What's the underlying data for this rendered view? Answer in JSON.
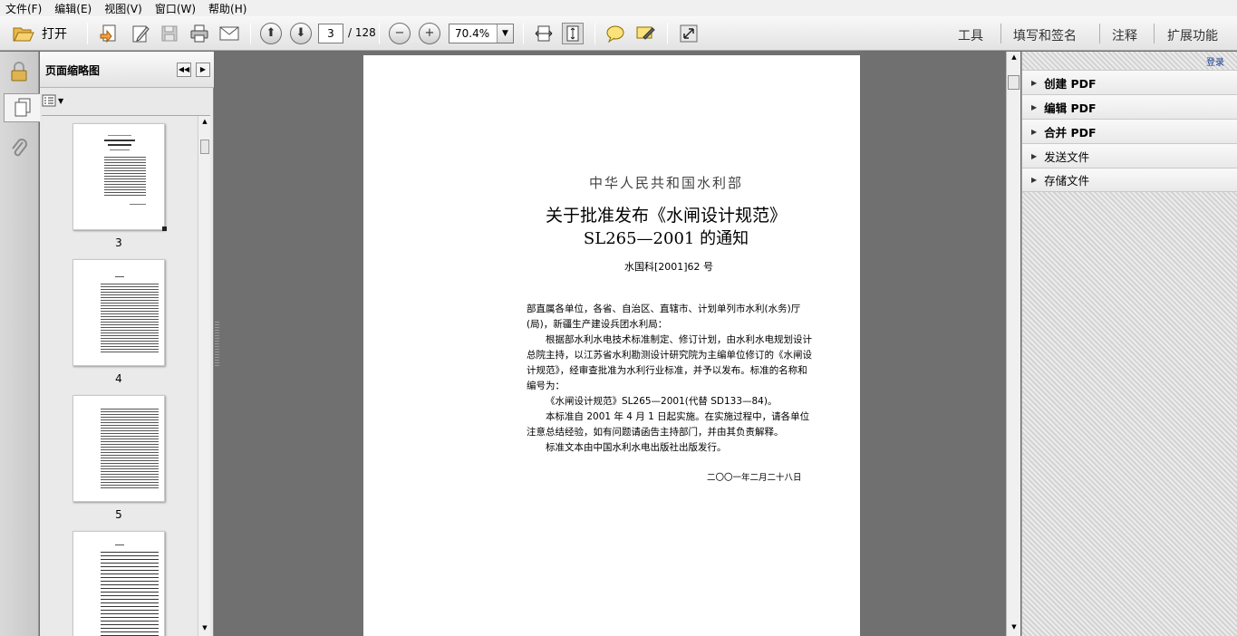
{
  "menu": [
    "文件(F)",
    "编辑(E)",
    "视图(V)",
    "窗口(W)",
    "帮助(H)"
  ],
  "toolbar": {
    "open_label": "打开",
    "page_current": "3",
    "page_total": "/ 128",
    "zoom": "70.4%",
    "right_tabs": [
      "工具",
      "填写和签名",
      "注释",
      "扩展功能"
    ]
  },
  "thumbnails": {
    "title": "页面缩略图",
    "pages": [
      "3",
      "4",
      "5"
    ]
  },
  "document": {
    "ministry": "中华人民共和国水利部",
    "title_line1": "关于批准发布《水闸设计规范》",
    "title_line2": "SL265—2001 的通知",
    "doc_number": "水国科[2001]62 号",
    "paragraphs": [
      "部直属各单位，各省、自治区、直辖市、计划单列市水利(水务)厅(局)，新疆生产建设兵团水利局：",
      "根据部水利水电技术标准制定、修订计划，由水利水电规划设计总院主持，以江苏省水利勘测设计研究院为主编单位修订的《水闸设计规范》，经审查批准为水利行业标准，并予以发布。标准的名称和编号为：",
      "《水闸设计规范》SL265—2001(代替 SD133—84)。",
      "本标准自 2001 年 4 月 1 日起实施。在实施过程中，请各单位注意总结经验，如有问题请函告主持部门，并由其负责解释。",
      "标准文本由中国水利水电出版社出版发行。"
    ],
    "date": "二〇〇一年二月二十八日"
  },
  "taskpane": {
    "login": "登录",
    "sections": [
      {
        "label": "创建 PDF",
        "bold": true
      },
      {
        "label": "编辑 PDF",
        "bold": true
      },
      {
        "label": "合并 PDF",
        "bold": true
      },
      {
        "label": "发送文件",
        "bold": false
      },
      {
        "label": "存储文件",
        "bold": false
      }
    ]
  }
}
